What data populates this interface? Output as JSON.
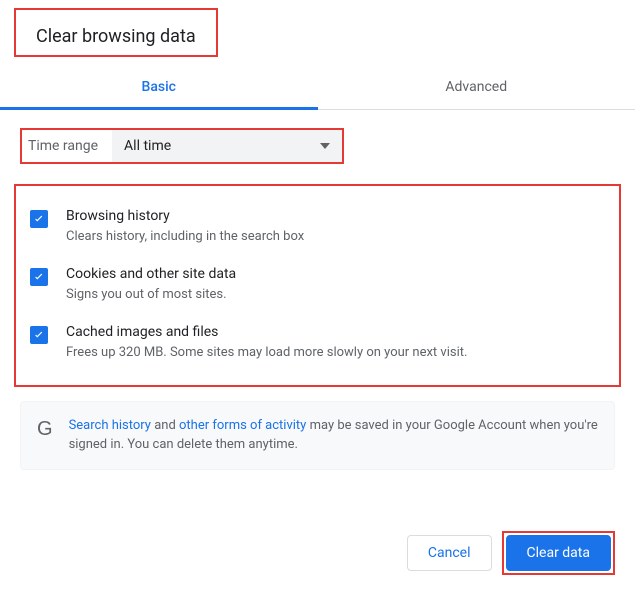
{
  "dialog": {
    "title": "Clear browsing data"
  },
  "tabs": {
    "basic": "Basic",
    "advanced": "Advanced"
  },
  "timeRange": {
    "label": "Time range",
    "value": "All time"
  },
  "options": [
    {
      "title": "Browsing history",
      "desc": "Clears history, including in the search box",
      "checked": true
    },
    {
      "title": "Cookies and other site data",
      "desc": "Signs you out of most sites.",
      "checked": true
    },
    {
      "title": "Cached images and files",
      "desc": "Frees up 320 MB. Some sites may load more slowly on your next visit.",
      "checked": true
    }
  ],
  "info": {
    "link1": "Search history",
    "mid1": " and ",
    "link2": "other forms of activity",
    "rest": " may be saved in your Google Account when you're signed in. You can delete them anytime."
  },
  "buttons": {
    "cancel": "Cancel",
    "clear": "Clear data"
  }
}
